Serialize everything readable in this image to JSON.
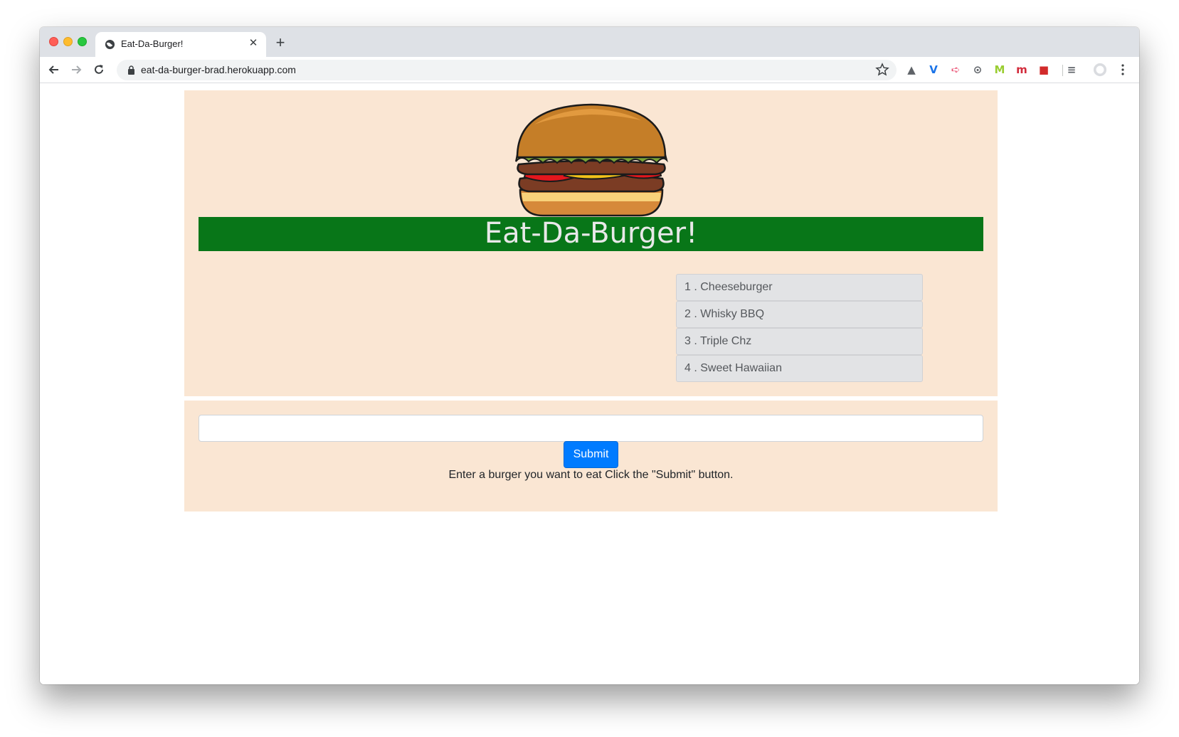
{
  "browser": {
    "tab": {
      "title": "Eat-Da-Burger!",
      "icon": "globe-icon",
      "close_glyph": "✕"
    },
    "new_tab_glyph": "+",
    "address_bar": {
      "url": "eat-da-burger-brad.herokuapp.com"
    },
    "extensions": [
      {
        "name": "drive-extension-icon",
        "glyph": "▲",
        "color": "#5f6368"
      },
      {
        "name": "v-extension-icon",
        "glyph": "V",
        "color": "#1a73e8"
      },
      {
        "name": "arrow-extension-icon",
        "glyph": "➪",
        "color": "#ea4c6f"
      },
      {
        "name": "code-extension-icon",
        "glyph": "⊙",
        "color": "#5f6368"
      },
      {
        "name": "m-green-extension-icon",
        "glyph": "M",
        "color": "#9acd32"
      },
      {
        "name": "m-red-extension-icon",
        "glyph": "m",
        "color": "#d22b3b"
      },
      {
        "name": "red-box-extension-icon",
        "glyph": "■",
        "color": "#d22b2b"
      },
      {
        "name": "playlist-icon",
        "glyph": "≡",
        "color": "#5f6368"
      }
    ]
  },
  "page": {
    "banner_title": "Eat-Da-Burger!",
    "burgers": [
      {
        "label": "1 . Cheeseburger"
      },
      {
        "label": "2 . Whisky BBQ"
      },
      {
        "label": "3 . Triple Chz"
      },
      {
        "label": "4 . Sweet Hawaiian"
      }
    ],
    "form": {
      "input_value": "",
      "input_placeholder": "",
      "submit_label": "Submit",
      "hint": "Enter a burger you want to eat Click the \"Submit\" button."
    }
  },
  "colors": {
    "panel_bg": "#fae6d3",
    "banner_bg": "#087618",
    "button_primary": "#007bff"
  }
}
